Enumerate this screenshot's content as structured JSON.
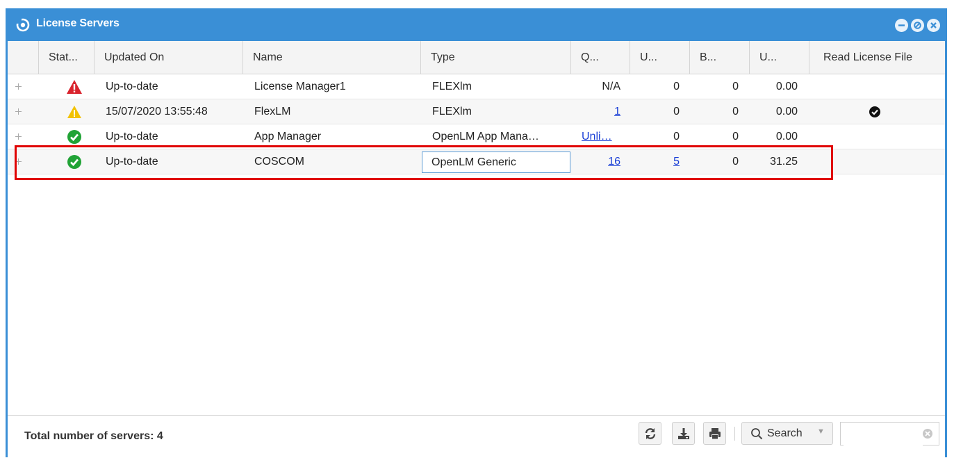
{
  "window": {
    "title": "License Servers"
  },
  "columns": [
    "Stat...",
    "Updated On",
    "Name",
    "Type",
    "Q...",
    "U...",
    "B...",
    "U...",
    "Read License File"
  ],
  "rows": [
    {
      "status": "error",
      "updated": "Up-to-date",
      "name": "License Manager1",
      "type": "FLEXlm",
      "q": "N/A",
      "u1": "0",
      "b": "0",
      "u2": "0.00",
      "read_license": false
    },
    {
      "status": "warning",
      "updated": "15/07/2020 13:55:48",
      "name": "FlexLM",
      "type": "FLEXlm",
      "q": "1",
      "u1": "0",
      "b": "0",
      "u2": "0.00",
      "read_license": true
    },
    {
      "status": "ok",
      "updated": "Up-to-date",
      "name": "App Manager",
      "type": "OpenLM App Mana…",
      "q": "Unli…",
      "u1": "0",
      "b": "0",
      "u2": "0.00",
      "read_license": false
    },
    {
      "status": "ok",
      "updated": "Up-to-date",
      "name": "COSCOM",
      "type": "OpenLM Generic",
      "q": "16",
      "u1": "5",
      "b": "0",
      "u2": "31.25",
      "read_license": false
    }
  ],
  "footer": {
    "total_label": "Total number of servers: 4",
    "search_label": "Search",
    "search_value": ""
  },
  "colors": {
    "titlebar": "#3a8fd6",
    "error": "#d9232d",
    "warning": "#f2c200",
    "ok": "#21a336",
    "link": "#1a3fd6",
    "highlight": "#e00000"
  }
}
